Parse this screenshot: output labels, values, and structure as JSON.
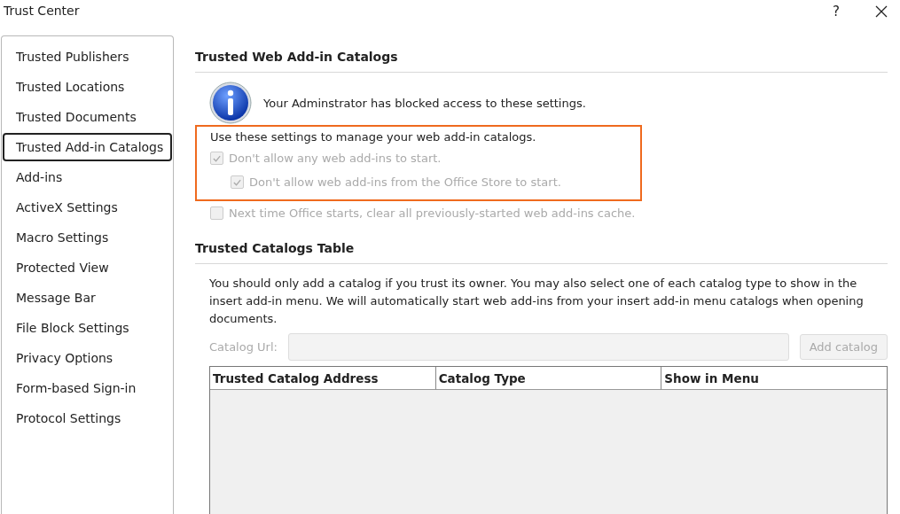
{
  "window": {
    "title": "Trust Center",
    "help": "?"
  },
  "sidebar": {
    "items": [
      {
        "label": "Trusted Publishers",
        "selected": false
      },
      {
        "label": "Trusted Locations",
        "selected": false
      },
      {
        "label": "Trusted Documents",
        "selected": false
      },
      {
        "label": "Trusted Add-in Catalogs",
        "selected": true
      },
      {
        "label": "Add-ins",
        "selected": false
      },
      {
        "label": "ActiveX Settings",
        "selected": false
      },
      {
        "label": "Macro Settings",
        "selected": false
      },
      {
        "label": "Protected View",
        "selected": false
      },
      {
        "label": "Message Bar",
        "selected": false
      },
      {
        "label": "File Block Settings",
        "selected": false
      },
      {
        "label": "Privacy Options",
        "selected": false
      },
      {
        "label": "Form-based Sign-in",
        "selected": false
      },
      {
        "label": "Protocol Settings",
        "selected": false
      }
    ]
  },
  "web_catalogs": {
    "heading": "Trusted Web Add-in Catalogs",
    "notice": "Your Adminstrator has blocked access to these settings.",
    "highlight_box": {
      "shown": true,
      "intro": "Use these settings to manage your web add-in catalogs.",
      "options": [
        {
          "label": "Don't allow any web add-ins to start.",
          "checked": true,
          "disabled": true,
          "children": [
            {
              "label": "Don't allow web add-ins from the Office Store to start.",
              "checked": true,
              "disabled": true
            }
          ]
        }
      ]
    },
    "options": [
      {
        "label": "Next time Office starts, clear all previously-started web add-ins cache.",
        "checked": false,
        "disabled": true
      }
    ]
  },
  "catalogs_table": {
    "heading": "Trusted Catalogs Table",
    "description": "You should only add a catalog if you trust its owner. You may also select one of each catalog type to show in the insert add-in menu. We will automatically start web add-ins from your insert add-in menu catalogs when opening documents.",
    "url_label": "Catalog Url:",
    "add_button": {
      "label": "Add catalog",
      "disabled": true
    },
    "columns": [
      "Trusted Catalog Address",
      "Catalog Type",
      "Show in Menu"
    ]
  }
}
